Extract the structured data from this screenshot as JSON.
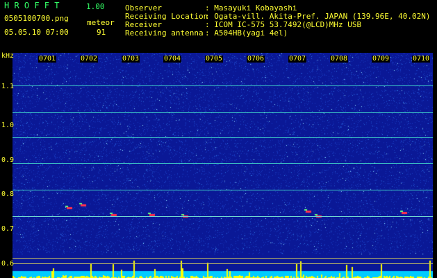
{
  "header": {
    "app_title": "H R O F F T",
    "version": "1.00",
    "filename": "0505100700.png",
    "mode": "meteor",
    "datetime": "05.05.10 07:00",
    "count": "91",
    "observer_label": "Observer",
    "observer_value": ": Masayuki Kobayashi",
    "location_label": "Receiving Location",
    "location_value": ": Ogata-vill. Akita-Pref. JAPAN (139.96E, 40.02N)",
    "receiver_label": "Receiver",
    "receiver_value": ": ICOM IC-575 53.7492(@LCD)MHz USB",
    "antenna_label": "Receiving antenna",
    "antenna_value": ": A504HB(yagi 4el)"
  },
  "axes": {
    "y_unit": "kHz",
    "y_ticks": [
      "1.1",
      "1.0",
      "0.9",
      "0.8",
      "0.7",
      "0.6"
    ],
    "x_ticks": [
      "0701",
      "0702",
      "0703",
      "0704",
      "0705",
      "0706",
      "0707",
      "0708",
      "0709",
      "0710"
    ]
  },
  "colors": {
    "label": "#ffff33",
    "title": "#33ff66",
    "background": "#0a1896",
    "carrier": "#3fd0c8",
    "noise_base": "#00ccff",
    "noise_peak": "#ffff00"
  }
}
